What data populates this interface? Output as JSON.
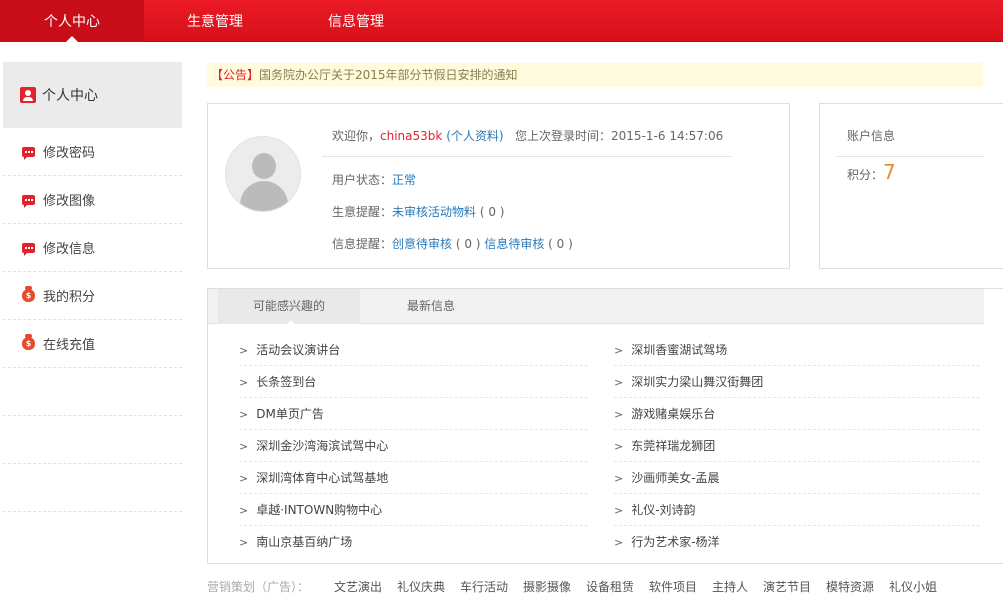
{
  "topnav": {
    "items": [
      "个人中心",
      "生意管理",
      "信息管理"
    ]
  },
  "sidebar": {
    "title": "个人中心",
    "items": [
      {
        "label": "修改密码",
        "icon": "chat-icon"
      },
      {
        "label": "修改图像",
        "icon": "chat-icon"
      },
      {
        "label": "修改信息",
        "icon": "chat-icon"
      },
      {
        "label": "我的积分",
        "icon": "money-bag-icon"
      },
      {
        "label": "在线充值",
        "icon": "money-bag-icon"
      }
    ]
  },
  "notice": {
    "tag": "【公告】",
    "text": "国务院办公厅关于2015年部分节假日安排的通知"
  },
  "profile": {
    "welcome": "欢迎你，",
    "username": "china53bk",
    "profile_link": "(个人资料)",
    "last_login_label": "您上次登录时间：",
    "last_login_time": "2015-1-6 14:57:06",
    "status_label": "用户状态：",
    "status_value": "正常",
    "biz_label": "生意提醒：",
    "biz_link": "未审核活动物料",
    "biz_count": "( 0 )",
    "info_label": "信息提醒：",
    "info_link1": "创意待审核",
    "info_count1": "( 0 )",
    "info_link2": "信息待审核",
    "info_count2": "( 0 )"
  },
  "account": {
    "title": "账户信息",
    "points_label": "积分：",
    "points_value": "7"
  },
  "tabs": [
    "可能感兴趣的",
    "最新信息"
  ],
  "list": {
    "left": [
      "活动会议演讲台",
      "长条签到台",
      "DM单页广告",
      "深圳金沙湾海滨试驾中心",
      "深圳湾体育中心试驾基地",
      "卓越·INTOWN购物中心",
      "南山京基百纳广场"
    ],
    "right": [
      "深圳香蜜湖试驾场",
      "深圳实力梁山舞汉街舞团",
      "游戏赌桌娱乐台",
      "东莞祥瑞龙狮团",
      "沙画师美女-孟晨",
      "礼仪-刘诗韵",
      "行为艺术家-杨洋"
    ]
  },
  "footer": {
    "label": "营销策划（广告）：",
    "links": [
      "文艺演出",
      "礼仪庆典",
      "车行活动",
      "摄影摄像",
      "设备租赁",
      "软件项目",
      "主持人",
      "演艺节目",
      "模特资源",
      "礼仪小姐"
    ]
  },
  "colors": {
    "brand_red": "#e0232d",
    "link_blue": "#2a7ab8",
    "points_orange": "#f08a24"
  }
}
